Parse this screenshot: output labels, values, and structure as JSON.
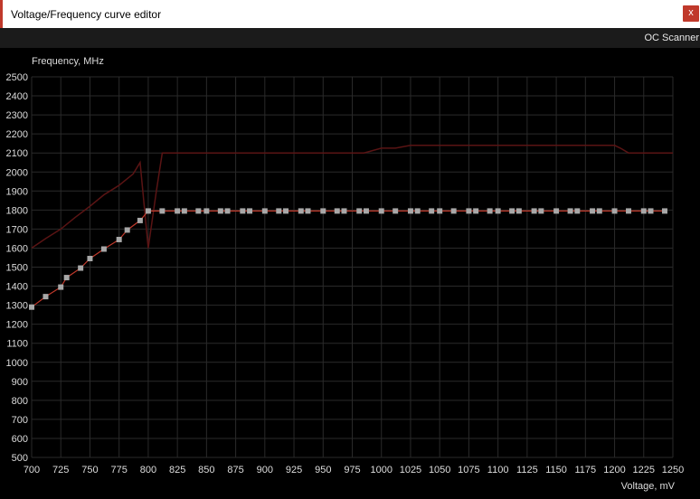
{
  "window": {
    "title": "Voltage/Frequency curve editor",
    "close_label": "x"
  },
  "toolbar": {
    "oc_scanner_label": "OC Scanner"
  },
  "colors": {
    "grid": "#2a2a2a",
    "axis_text": "#dddddd",
    "curve": "#c0392b",
    "limit_curve": "#5a1414",
    "point": "#a8a8a8",
    "close_bg": "#c0392b"
  },
  "chart_data": {
    "type": "line",
    "ylabel": "Frequency, MHz",
    "xlabel": "Voltage, mV",
    "xlim": [
      700,
      1250
    ],
    "ylim": [
      500,
      2500
    ],
    "x_ticks": [
      700,
      725,
      750,
      775,
      800,
      825,
      850,
      875,
      900,
      925,
      950,
      975,
      1000,
      1025,
      1050,
      1075,
      1100,
      1125,
      1150,
      1175,
      1200,
      1225,
      1250
    ],
    "y_ticks": [
      500,
      600,
      700,
      800,
      900,
      1000,
      1100,
      1200,
      1300,
      1400,
      1500,
      1600,
      1700,
      1800,
      1900,
      2000,
      2100,
      2200,
      2300,
      2400,
      2500
    ],
    "grid": true,
    "series": [
      {
        "role": "limit",
        "x": [
          700,
          712,
          725,
          737,
          750,
          762,
          775,
          787,
          793,
          800,
          807,
          812,
          825,
          850,
          875,
          900,
          925,
          950,
          975,
          985,
          1000,
          1012,
          1025,
          1050,
          1075,
          1100,
          1125,
          1150,
          1175,
          1200,
          1205,
          1212,
          1225,
          1250
        ],
        "y": [
          1600,
          1650,
          1700,
          1760,
          1820,
          1880,
          1930,
          1990,
          2050,
          1600,
          1900,
          2100,
          2100,
          2100,
          2100,
          2100,
          2100,
          2100,
          2100,
          2100,
          2125,
          2125,
          2140,
          2140,
          2140,
          2140,
          2140,
          2140,
          2140,
          2140,
          2125,
          2100,
          2100,
          2100
        ]
      },
      {
        "role": "curve",
        "x": [
          700,
          712,
          725,
          730,
          742,
          750,
          762,
          775,
          782,
          793,
          800,
          812,
          825,
          831,
          843,
          850,
          862,
          868,
          881,
          887,
          900,
          912,
          918,
          931,
          937,
          950,
          962,
          968,
          981,
          987,
          1000,
          1012,
          1025,
          1031,
          1043,
          1050,
          1062,
          1075,
          1081,
          1093,
          1100,
          1112,
          1118,
          1131,
          1137,
          1150,
          1162,
          1168,
          1181,
          1187,
          1200,
          1212,
          1225,
          1231,
          1243
        ],
        "y": [
          1290,
          1345,
          1395,
          1445,
          1495,
          1545,
          1595,
          1645,
          1695,
          1745,
          1795,
          1795,
          1795,
          1795,
          1795,
          1795,
          1795,
          1795,
          1795,
          1795,
          1795,
          1795,
          1795,
          1795,
          1795,
          1795,
          1795,
          1795,
          1795,
          1795,
          1795,
          1795,
          1795,
          1795,
          1795,
          1795,
          1795,
          1795,
          1795,
          1795,
          1795,
          1795,
          1795,
          1795,
          1795,
          1795,
          1795,
          1795,
          1795,
          1795,
          1795,
          1795,
          1795,
          1795,
          1795
        ]
      }
    ]
  }
}
